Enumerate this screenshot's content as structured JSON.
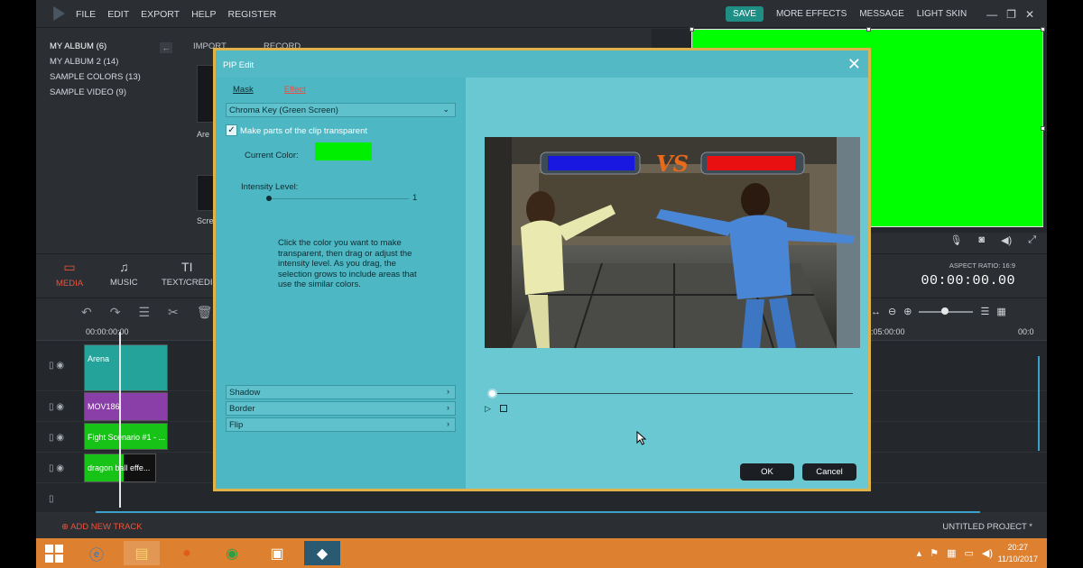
{
  "menubar": {
    "items": [
      "FILE",
      "EDIT",
      "EXPORT",
      "HELP",
      "REGISTER"
    ],
    "save": "SAVE",
    "more_effects": "MORE EFFECTS",
    "message": "MESSAGE",
    "light_skin": "LIGHT SKIN"
  },
  "albums": [
    "MY ALBUM (6)",
    "MY ALBUM 2 (14)",
    "SAMPLE COLORS (13)",
    "SAMPLE VIDEO (9)"
  ],
  "library": {
    "import": "IMPORT",
    "record": "RECORD",
    "thumb1_label": "Are",
    "thumb2_label": "Scre"
  },
  "tabs": {
    "media": "MEDIA",
    "music": "MUSIC",
    "text": "TEXT/CREDI"
  },
  "aspect": {
    "label": "ASPECT RATIO: 16:9",
    "timecode": "00:00:00.00"
  },
  "ruler": {
    "start": "00:00:00:00",
    "mid": ":05:00:00",
    "end": "00:0"
  },
  "clips": {
    "arena": "Arena",
    "mov": "MOV186",
    "fight": "Fight Scenario #1 - ...",
    "dragon": "dragon ball effe..."
  },
  "status": {
    "add_track": "ADD NEW TRACK",
    "project": "UNTITLED PROJECT *"
  },
  "taskbar": {
    "time": "20:27",
    "date": "11/10/2017"
  },
  "dialog": {
    "title": "PIP Edit",
    "tab_mask": "Mask",
    "tab_effect": "Effect",
    "mode": "Chroma Key (Green Screen)",
    "checkbox_label": "Make parts of the clip transparent",
    "checkbox_checked": true,
    "current_color_label": "Current Color:",
    "current_color": "#00ee00",
    "intensity_label": "Intensity Level:",
    "intensity_value": "1",
    "help_text": "Click the color you want to make transparent, then drag or adjust the intensity level. As you drag, the selection grows to include areas that use the similar colors.",
    "accordion": [
      "Shadow",
      "Border",
      "Flip"
    ],
    "preview_text": "VS",
    "ok": "OK",
    "cancel": "Cancel"
  },
  "colors": {
    "accent_orange": "#e8553d",
    "save_teal": "#1f8f86",
    "dialog_bg": "#4db8c4",
    "dialog_border": "#e0b24a",
    "green_screen": "#00ff00",
    "taskbar": "#dd8130"
  }
}
